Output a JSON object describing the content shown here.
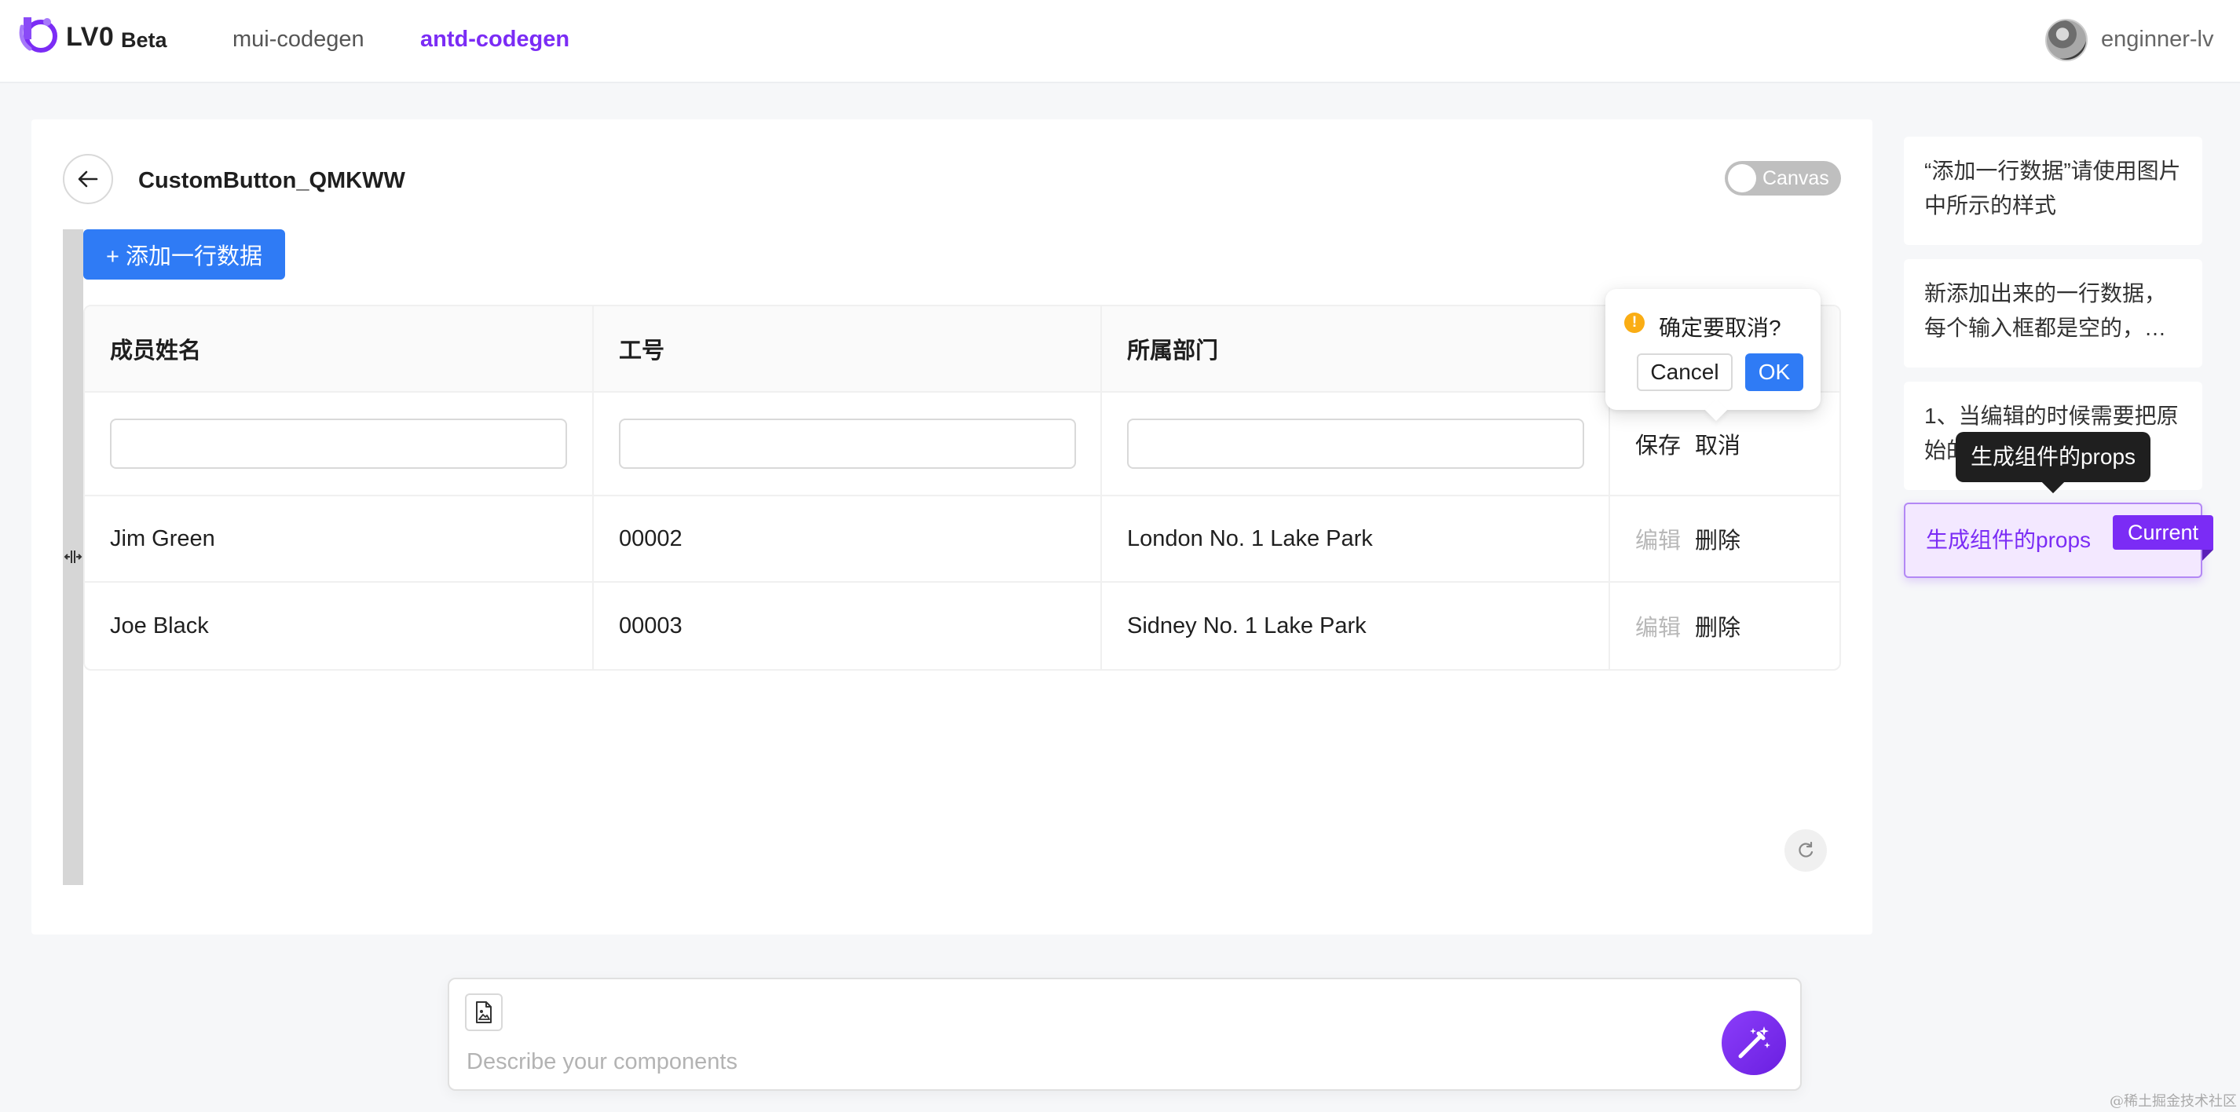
{
  "header": {
    "brand": "LV0",
    "beta": "Beta",
    "nav": [
      "mui-codegen",
      "antd-codegen"
    ],
    "active_nav": "antd-codegen",
    "username": "enginner-lv"
  },
  "editor": {
    "component_name": "CustomButton_QMKWW",
    "canvas_toggle_label": "Canvas",
    "add_row_button": "+ 添加一行数据",
    "table": {
      "columns": [
        "成员姓名",
        "工号",
        "所属部门",
        ""
      ],
      "editing_row_actions": {
        "save": "保存",
        "cancel": "取消"
      },
      "rows": [
        {
          "name": "Jim Green",
          "id": "00002",
          "dept": "London No. 1 Lake Park",
          "edit": "编辑",
          "delete": "删除"
        },
        {
          "name": "Joe Black",
          "id": "00003",
          "dept": "Sidney No. 1 Lake Park",
          "edit": "编辑",
          "delete": "删除"
        }
      ]
    },
    "popconfirm": {
      "message": "确定要取消?",
      "cancel": "Cancel",
      "ok": "OK"
    }
  },
  "history": {
    "items": [
      "“添加一行数据”请使用图片中所示的样式",
      "新添加出来的一行数据，每个输入框都是空的，…",
      "1、当编辑的时候需要把原始的…",
      "生成组件的props"
    ],
    "current_badge": "Current",
    "tooltip": "生成组件的props"
  },
  "prompt": {
    "placeholder": "Describe your components",
    "value": ""
  },
  "watermark": "@稀土掘金技术社区",
  "colors": {
    "accent_purple": "#7b2cf5",
    "primary_blue": "#2f7bf5",
    "warning": "#faad14"
  },
  "icons": [
    "logo-icon",
    "arrow-left-icon",
    "drag-handle-icon",
    "warning-icon",
    "refresh-icon",
    "image-file-icon",
    "magic-wand-icon"
  ]
}
